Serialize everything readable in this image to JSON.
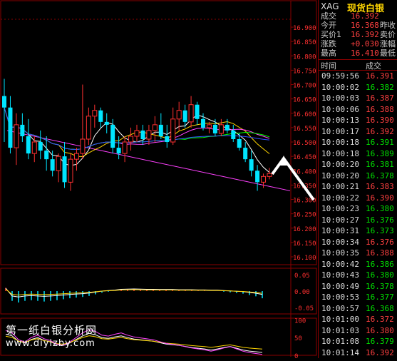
{
  "symbol": {
    "code": "XAG",
    "name": "现货白银"
  },
  "quote": [
    {
      "label": "成交",
      "value": "16.392",
      "extra": ""
    },
    {
      "label": "今开",
      "value": "16.368",
      "extra": "昨收"
    },
    {
      "label": "买价1",
      "value": "16.392",
      "extra": "卖价"
    },
    {
      "label": "涨跌",
      "value": "+0.030",
      "extra": "涨幅"
    },
    {
      "label": "最高",
      "value": "16.410",
      "extra": "最低"
    }
  ],
  "ticks_header": {
    "time": "时间",
    "price": "成交"
  },
  "ticks": [
    {
      "time": "09:59:56",
      "price": "16.391"
    },
    {
      "time": "10:00:02",
      "price": "16.382"
    },
    {
      "time": "10:00:03",
      "price": "16.387"
    },
    {
      "time": "10:00:06",
      "price": "16.388"
    },
    {
      "time": "10:00:13",
      "price": "16.390"
    },
    {
      "time": "10:00:17",
      "price": "16.392"
    },
    {
      "time": "10:00:18",
      "price": "16.391"
    },
    {
      "time": "10:00:18",
      "price": "16.389"
    },
    {
      "time": "10:00:20",
      "price": "16.381"
    },
    {
      "time": "10:00:20",
      "price": "16.378"
    },
    {
      "time": "10:00:21",
      "price": "16.383"
    },
    {
      "time": "10:00:22",
      "price": "16.390"
    },
    {
      "time": "10:00:23",
      "price": "16.380"
    },
    {
      "time": "10:00:27",
      "price": "16.376"
    },
    {
      "time": "10:00:31",
      "price": "16.373"
    },
    {
      "time": "10:00:34",
      "price": "16.376"
    },
    {
      "time": "10:00:35",
      "price": "16.388"
    },
    {
      "time": "10:00:42",
      "price": "16.386"
    },
    {
      "time": "10:00:43",
      "price": "16.380"
    },
    {
      "time": "10:00:49",
      "price": "16.378"
    },
    {
      "time": "10:00:53",
      "price": "16.377"
    },
    {
      "time": "10:00:57",
      "price": "16.368"
    },
    {
      "time": "10:01:00",
      "price": "16.372"
    },
    {
      "time": "10:01:03",
      "price": "16.380"
    },
    {
      "time": "10:01:08",
      "price": "16.379"
    },
    {
      "time": "10:01:14",
      "price": "16.392"
    }
  ],
  "watermark": {
    "line1": "第一纸白银分析网",
    "line2": "www.diyizby.com"
  },
  "colors": {
    "up": "#ff3030",
    "down": "#00e5ff",
    "grid": "#8a0000",
    "ma5": "#ffffff",
    "ma10": "#ffd600",
    "ma20": "#ff44ff",
    "ma30": "#00ff00",
    "ma60": "#3050ff",
    "trend": "#ff40ff"
  },
  "chart_data": [
    {
      "type": "candlestick",
      "yticks": [
        "16.900",
        "16.850",
        "16.800",
        "16.750",
        "16.700",
        "16.650",
        "16.600",
        "16.550",
        "16.500",
        "16.450",
        "16.400",
        "16.350",
        "16.300",
        "16.250",
        "16.200",
        "16.150",
        "16.100"
      ],
      "ylim": [
        16.1,
        16.92
      ],
      "candles": [
        [
          16.66,
          16.72,
          16.5,
          16.62
        ],
        [
          16.62,
          16.66,
          16.46,
          16.48
        ],
        [
          16.48,
          16.6,
          16.42,
          16.56
        ],
        [
          16.56,
          16.6,
          16.5,
          16.52
        ],
        [
          16.52,
          16.58,
          16.44,
          16.46
        ],
        [
          16.46,
          16.52,
          16.43,
          16.5
        ],
        [
          16.5,
          16.54,
          16.44,
          16.47
        ],
        [
          16.47,
          16.52,
          16.4,
          16.44
        ],
        [
          16.44,
          16.47,
          16.38,
          16.4
        ],
        [
          16.4,
          16.46,
          16.36,
          16.45
        ],
        [
          16.45,
          16.5,
          16.34,
          16.36
        ],
        [
          16.36,
          16.46,
          16.33,
          16.44
        ],
        [
          16.44,
          16.48,
          16.4,
          16.46
        ],
        [
          16.46,
          16.7,
          16.44,
          16.51
        ],
        [
          16.51,
          16.62,
          16.49,
          16.59
        ],
        [
          16.59,
          16.63,
          16.55,
          16.61
        ],
        [
          16.61,
          16.62,
          16.55,
          16.57
        ],
        [
          16.57,
          16.6,
          16.53,
          16.56
        ],
        [
          16.56,
          16.58,
          16.46,
          16.48
        ],
        [
          16.48,
          16.52,
          16.44,
          16.46
        ],
        [
          16.46,
          16.52,
          16.43,
          16.5
        ],
        [
          16.5,
          16.55,
          16.47,
          16.52
        ],
        [
          16.52,
          16.56,
          16.5,
          16.54
        ],
        [
          16.54,
          16.56,
          16.49,
          16.51
        ],
        [
          16.51,
          16.56,
          16.49,
          16.54
        ],
        [
          16.54,
          16.59,
          16.5,
          16.56
        ],
        [
          16.56,
          16.6,
          16.51,
          16.52
        ],
        [
          16.52,
          16.56,
          16.48,
          16.5
        ],
        [
          16.5,
          16.62,
          16.49,
          16.58
        ],
        [
          16.58,
          16.64,
          16.54,
          16.61
        ],
        [
          16.61,
          16.63,
          16.55,
          16.57
        ],
        [
          16.57,
          16.66,
          16.55,
          16.63
        ],
        [
          16.63,
          16.64,
          16.56,
          16.58
        ],
        [
          16.58,
          16.6,
          16.54,
          16.55
        ],
        [
          16.55,
          16.57,
          16.53,
          16.56
        ],
        [
          16.56,
          16.58,
          16.52,
          16.53
        ],
        [
          16.53,
          16.58,
          16.52,
          16.56
        ],
        [
          16.56,
          16.58,
          16.53,
          16.54
        ],
        [
          16.54,
          16.56,
          16.5,
          16.51
        ],
        [
          16.51,
          16.53,
          16.47,
          16.48
        ],
        [
          16.48,
          16.5,
          16.43,
          16.44
        ],
        [
          16.44,
          16.47,
          16.38,
          16.4
        ],
        [
          16.4,
          16.42,
          16.33,
          16.36
        ],
        [
          16.36,
          16.39,
          16.34,
          16.38
        ],
        [
          16.38,
          16.41,
          16.37,
          16.39
        ]
      ]
    },
    {
      "type": "bar",
      "yticks": [
        "0.05",
        "0.00",
        "-0.05"
      ],
      "ylim": [
        -0.07,
        0.07
      ],
      "series": [
        {
          "values": [
            0.01,
            -0.03,
            -0.035,
            -0.03,
            -0.028,
            -0.03,
            -0.032,
            -0.03,
            -0.028,
            -0.025,
            -0.022,
            -0.02,
            -0.018,
            -0.015,
            -0.01,
            -0.005,
            -0.002,
            0.0,
            0.004,
            0.005,
            0.006,
            0.005,
            0.004,
            0.004,
            0.003,
            0.003,
            0.003,
            0.002,
            0.002,
            0.002,
            0.001,
            0.001,
            0.0,
            0.0,
            -0.002,
            -0.004,
            -0.006,
            -0.008,
            -0.012,
            -0.016,
            -0.022
          ]
        }
      ]
    },
    {
      "type": "line",
      "yticks": [
        "100",
        "50",
        "0"
      ],
      "ylim": [
        0,
        105
      ]
    }
  ]
}
